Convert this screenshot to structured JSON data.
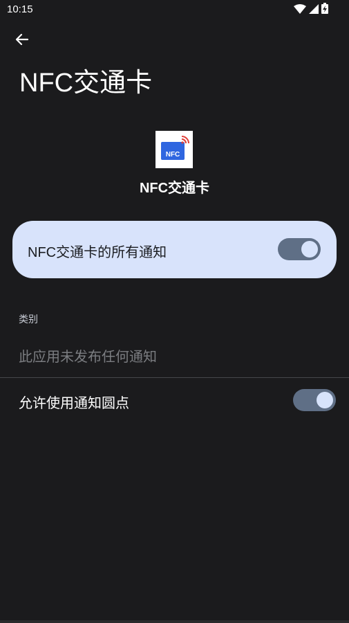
{
  "status_bar": {
    "time": "10:15",
    "icons": [
      "wifi-icon",
      "signal-icon",
      "battery-charging-icon"
    ]
  },
  "header": {
    "back_icon": "arrow-back-icon",
    "title": "NFC交通卡"
  },
  "app": {
    "icon_text": "NFC",
    "name": "NFC交通卡"
  },
  "all_notifications": {
    "label": "NFC交通卡的所有通知",
    "enabled": true
  },
  "categories": {
    "header": "类别",
    "empty_message": "此应用未发布任何通知"
  },
  "notification_dot": {
    "label": "允许使用通知圆点",
    "enabled": true
  },
  "colors": {
    "background": "#1b1b1d",
    "card_background": "#d8e3fb",
    "toggle_track": "#5f6f86",
    "toggle_thumb": "#d7e3fb",
    "app_icon_blue": "#2f66e0",
    "nfc_waves_red": "#e0403a"
  }
}
